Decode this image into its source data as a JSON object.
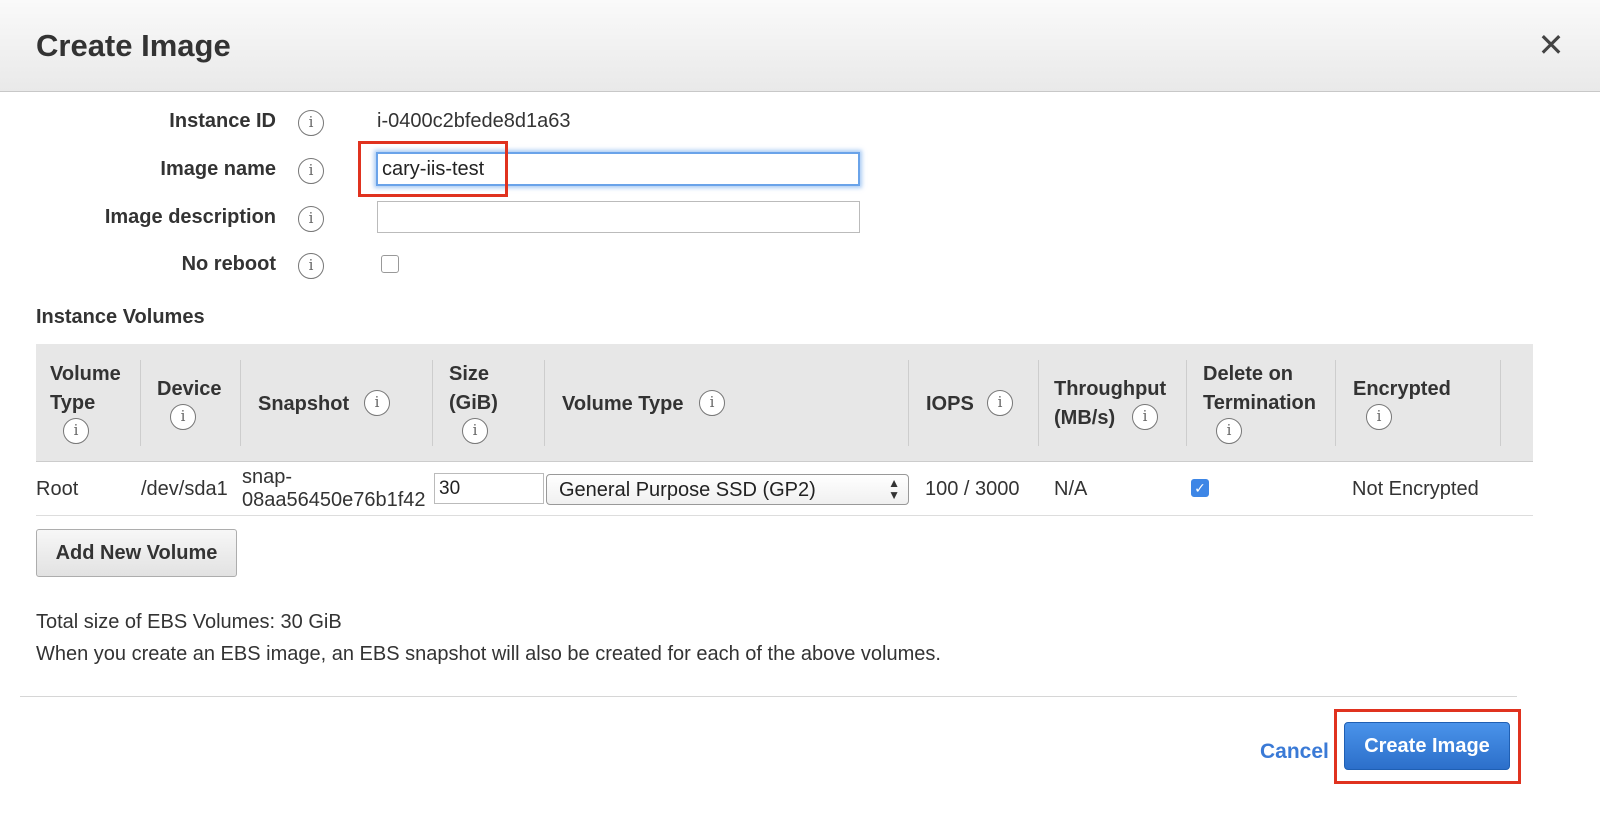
{
  "dialog": {
    "title": "Create Image",
    "close_icon": "close-icon"
  },
  "form": {
    "instance_id_label": "Instance ID",
    "instance_id_value": "i-0400c2bfede8d1a63",
    "image_name_label": "Image name",
    "image_name_value": "cary-iis-test",
    "image_description_label": "Image description",
    "image_description_value": "",
    "no_reboot_label": "No reboot",
    "no_reboot_checked": false,
    "info_glyph": "i"
  },
  "volumes": {
    "section_title": "Instance Volumes",
    "headers": {
      "volume_type_1": "Volume",
      "volume_type_2": "Type",
      "device": "Device",
      "snapshot": "Snapshot",
      "size_1": "Size",
      "size_2": "(GiB)",
      "volume_type": "Volume Type",
      "iops": "IOPS",
      "throughput_1": "Throughput",
      "throughput_2": "(MB/s)",
      "delete_1": "Delete on",
      "delete_2": "Termination",
      "encrypted": "Encrypted"
    },
    "rows": [
      {
        "volume_type": "Root",
        "device": "/dev/sda1",
        "snapshot_1": "snap-",
        "snapshot_2": "08aa56450e76b1f42",
        "size": "30",
        "ebs_type": "General Purpose SSD (GP2)",
        "iops": "100 / 3000",
        "throughput": "N/A",
        "delete_on_termination": true,
        "encrypted": "Not Encrypted"
      }
    ],
    "add_button_label": "Add New Volume"
  },
  "summary": {
    "total_size": "Total size of EBS Volumes: 30 GiB",
    "note": "When you create an EBS image, an EBS snapshot will also be created for each of the above volumes."
  },
  "footer": {
    "cancel_label": "Cancel",
    "create_label": "Create Image"
  },
  "colors": {
    "primary": "#2c6fca",
    "link": "#3a7ad6",
    "highlight": "#e0321f",
    "checkbox": "#3d86e6"
  }
}
